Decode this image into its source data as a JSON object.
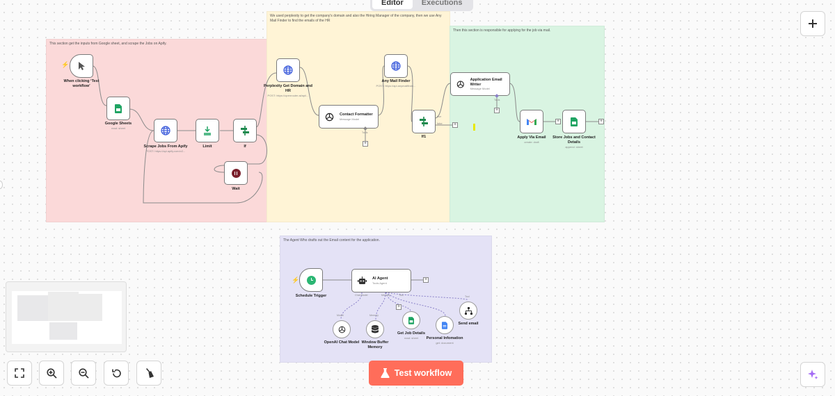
{
  "tabs": {
    "editor": "Editor",
    "executions": "Executions"
  },
  "sticky_notes": {
    "red": "This section get the inputs from Google sheet, and scrape the Jobs on Apify.",
    "yellow": "We used perplexity to get the company's domain and also the Hiring Manager of the company, then we use Any Mail Finder to find the emails of the HR",
    "green": "Then this section is responsible for applying for the job via mail.",
    "purple": "The Agent Who drafts out the Email content for the application."
  },
  "nodes": {
    "trigger": {
      "label": "When clicking ‘Test workflow’"
    },
    "google_sheets": {
      "label": "Google Sheets",
      "sub": "read: sheet"
    },
    "scrape_jobs": {
      "label": "Scrape Jobs From Apify",
      "sub": "POST: https://api.apify.com/v2..."
    },
    "limit": {
      "label": "Limit"
    },
    "if": {
      "label": "If"
    },
    "wait": {
      "label": "Wait"
    },
    "perplexity": {
      "label": "Perplexity Get Domain and HR",
      "sub": "POST: https://openrouter.ai/api/..."
    },
    "contact_formatter": {
      "label": "Contact Formatter",
      "sub": "Message Model",
      "output": "Tools"
    },
    "any_mail_finder": {
      "label": "Any Mail Finder",
      "sub": "POST: https://api.anymailfinde..."
    },
    "if1": {
      "label": "If1",
      "true_label": "true",
      "false_label": "false"
    },
    "application_writer": {
      "label": "Application Email Writer",
      "sub": "Message Model",
      "output": "Tools"
    },
    "apply_via_email": {
      "label": "Apply Via Email",
      "sub": "create: draft"
    },
    "store_jobs": {
      "label": "Store Jobs and Contact Details",
      "sub": "append: sheet"
    },
    "schedule_trigger": {
      "label": "Schedule Trigger"
    },
    "ai_agent": {
      "label": "AI Agent",
      "sub": "Tools Agent",
      "ports": [
        "Chat Model",
        "Memory",
        "Tool"
      ]
    },
    "openai_model": {
      "label": "OpenAI Chat Model",
      "port": "Model"
    },
    "window_memory": {
      "label": "Window Buffer Memory",
      "port": "Memory"
    },
    "get_job_details": {
      "label": "Get Job Details",
      "sub": "read: sheet"
    },
    "personal_info": {
      "label": "Personal Infomation",
      "sub": "get: document"
    },
    "send_email": {
      "label": "Send email",
      "port": "Tool"
    }
  },
  "buttons": {
    "test_workflow": "Test workflow"
  },
  "colors": {
    "sticky_red": "#fbd9d9",
    "sticky_yellow": "#fff4d6",
    "sticky_green": "#d9f4e2",
    "sticky_purple": "#e4e2f6",
    "accent": "#ff6d5a"
  }
}
